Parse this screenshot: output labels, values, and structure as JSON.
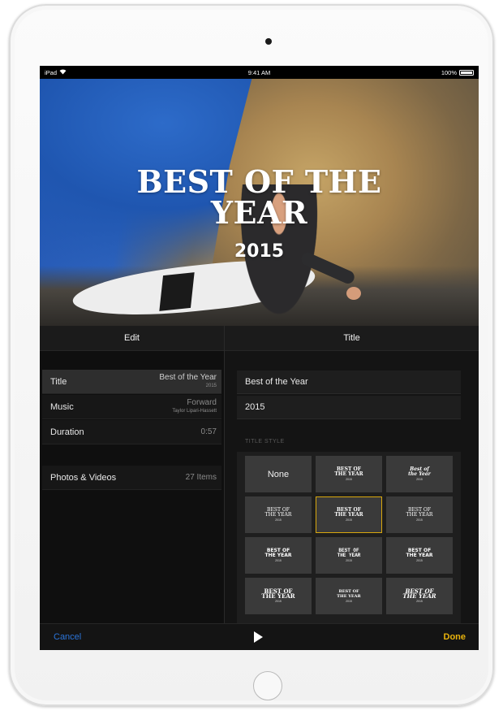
{
  "status_bar": {
    "device": "iPad",
    "time": "9:41 AM",
    "battery": "100%"
  },
  "preview": {
    "title": "BEST OF THE YEAR",
    "year": "2015"
  },
  "edit_panel": {
    "header": "Edit",
    "rows": [
      {
        "label": "Title",
        "value": "Best of the Year",
        "sub": "2015"
      },
      {
        "label": "Music",
        "value": "Forward",
        "sub": "Taylor Lipari-Hassett"
      },
      {
        "label": "Duration",
        "value": "0:57"
      }
    ],
    "media_row": {
      "label": "Photos & Videos",
      "value": "27 Items"
    }
  },
  "title_panel": {
    "header": "Title",
    "fields": [
      "Best of the Year",
      "2015"
    ],
    "section_label": "TITLE STYLE",
    "styles": [
      {
        "label": "None"
      },
      {
        "line1": "BEST OF",
        "line2": "THE YEAR",
        "sub": "2015"
      },
      {
        "line1": "Best of",
        "line2": "the Year",
        "sub": "2015"
      },
      {
        "line1": "BEST OF",
        "line2": "THE YEAR",
        "sub": "2015"
      },
      {
        "line1": "BEST OF",
        "line2": "THE YEAR",
        "sub": "2015"
      },
      {
        "line1": "BEST OF",
        "line2": "THE YEAR",
        "sub": "2015"
      },
      {
        "line1": "BEST OF",
        "line2": "THE YEAR",
        "sub": "2015"
      },
      {
        "line1": "BEST OF",
        "line2": "THE YEAR",
        "sub": "2015"
      },
      {
        "line1": "BEST OF",
        "line2": "THE YEAR",
        "sub": "2015"
      },
      {
        "line1": "BEST OF",
        "line2": "THE YEAR",
        "sub": "2015"
      },
      {
        "line1": "BEST OF",
        "line2": "THE YEAR",
        "sub": "2015"
      },
      {
        "line1": "BEST OF",
        "line2": "THE YEAR",
        "sub": "2015"
      }
    ],
    "selected_style_index": 4
  },
  "toolbar": {
    "cancel_label": "Cancel",
    "done_label": "Done"
  },
  "colors": {
    "accent_blue": "#2b74d9",
    "accent_gold": "#e9b30c",
    "selection_border": "#d8a70e"
  }
}
